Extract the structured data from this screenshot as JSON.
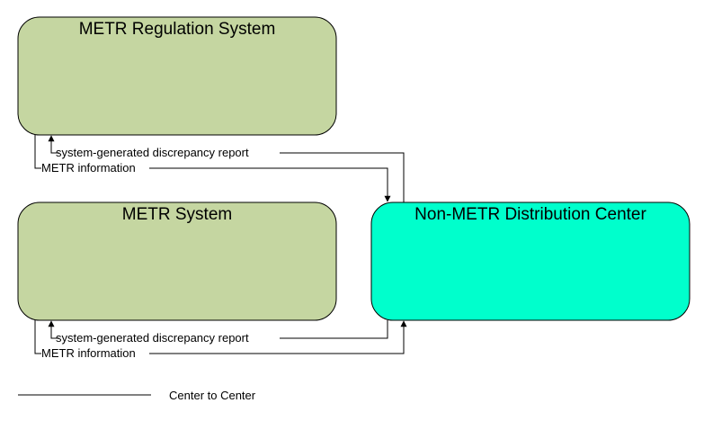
{
  "boxes": {
    "regulation": {
      "title": "METR Regulation System",
      "color": "#c5d6a1"
    },
    "metr": {
      "title": "METR System",
      "color": "#c5d6a1"
    },
    "distribution": {
      "title": "Non-METR Distribution Center",
      "color": "#00ffcc"
    }
  },
  "flows": {
    "reg_discrepancy": "system-generated discrepancy report",
    "reg_info": "METR information",
    "metr_discrepancy": "system-generated discrepancy report",
    "metr_info": "METR information"
  },
  "legend": {
    "label": "Center to Center",
    "line_color": "#000000"
  }
}
